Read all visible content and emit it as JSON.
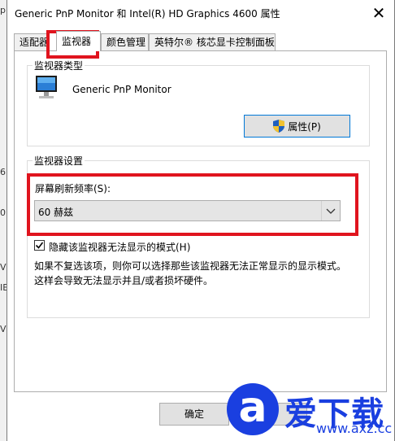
{
  "background": {
    "fragments": [
      "p",
      "6",
      "0",
      "V",
      "IE",
      "V"
    ]
  },
  "window": {
    "title": "Generic PnP Monitor 和 Intel(R) HD Graphics 4600 属性",
    "close_glyph": "✕"
  },
  "tabs": [
    {
      "label": "适配器",
      "active": false
    },
    {
      "label": "监视器",
      "active": true
    },
    {
      "label": "颜色管理",
      "active": false
    },
    {
      "label": "英特尔® 核芯显卡控制面板",
      "active": false
    }
  ],
  "monitor_type": {
    "group_label": "监视器类型",
    "monitor_name": "Generic PnP Monitor",
    "properties_button": "属性(P)",
    "icon": "monitor-icon"
  },
  "monitor_settings": {
    "group_label": "监视器设置",
    "refresh_label": "屏幕刷新频率(S):",
    "refresh_value": "60 赫兹",
    "hide_modes_label": "隐藏该监视器无法显示的模式(H)",
    "hide_modes_checked": true,
    "description_line1": "如果不复选该项，则你可以选择那些该监视器无法正常显示的显示模式。",
    "description_line2": "这样会导致无法显示并且/或者损坏硬件。"
  },
  "footer": {
    "ok_label": "确定",
    "cancel_label": "取"
  },
  "watermark": {
    "logo_glyph": "a",
    "title": "爱下载",
    "url": "www.axz.cc"
  },
  "colors": {
    "highlight_red": "#e0141e",
    "watermark_blue": "#1a3fe0",
    "focus_blue": "#0078d7"
  }
}
